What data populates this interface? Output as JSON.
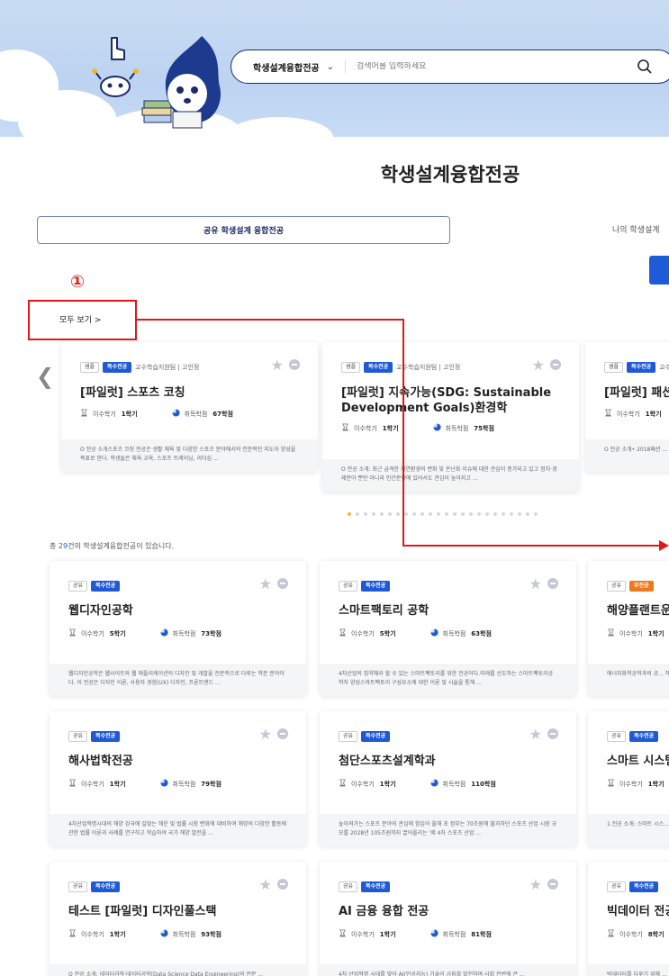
{
  "search": {
    "category": "학생설계융합전공",
    "placeholder": "검색어를 입력하세요"
  },
  "page_title": "학생설계융합전공",
  "tabs": [
    {
      "label": "공유 학생설계 융합전공"
    },
    {
      "label": "나의 학생설계"
    }
  ],
  "annotation_marker": "①",
  "view_all": "모두 보기 >",
  "total": {
    "prefix": "총 ",
    "count": "29",
    "suffix": "건의 학생설계융합전공이 있습니다."
  },
  "stats_labels": {
    "semester": "이수학기",
    "credits": "취득학점"
  },
  "featured": [
    {
      "tags": [
        "샘플",
        "복수전공"
      ],
      "meta": "교수학습지원팀 | 고인정",
      "title": "[파일럿] 스포츠 코칭",
      "semester": "1학기",
      "credits": "67학점",
      "desc": "O 전공 소개스포츠 코칭 전공은 생활 체육 및 다양한 스포츠 분야에서의 전문적인 지도자 양성을 목표로 한다. 학생들은 체육 교육, 스포츠 트레이닝, 리더십 ..."
    },
    {
      "tags": [
        "샘플",
        "복수전공"
      ],
      "meta": "교수학습지원팀 | 고인정",
      "title": "[파일럿] 지속가능(SDG: Sustainable Development Goals)환경학",
      "semester": "1학기",
      "credits": "75학점",
      "desc": "O 전공 소개: 최근 급격한 자연환경의 변화 및 온난화 이슈에 대한 관심이 증가되고 있고 정치·경제분야 뿐만 아니라 인간분야에 있어서도 관심이 높아지고 ..."
    },
    {
      "tags": [
        "샘플",
        "복수전공"
      ],
      "meta": "교수",
      "title": "[파일럿] 패션 ...",
      "semester": "1학기",
      "credits": "",
      "desc": "O 전공 소개• 2018패션 ... 디자인, 소비자학과가 융합 ..."
    }
  ],
  "dots": {
    "count": 24,
    "active_index": 0
  },
  "grid": [
    {
      "tags": [
        "공유",
        "복수전공"
      ],
      "title": "웹디자인공학",
      "semester": "5학기",
      "credits": "73학점",
      "desc": "웹디자인공학은 웹사이트와 웹 애플리케이션의 디자인 및 개발을 전문적으로 다루는 학문 분야이다. 이 전공은 디자인 이론, 사용자 경험(UX) 디자인, 프론트엔드 ..."
    },
    {
      "tags": [
        "공유",
        "복수전공"
      ],
      "title": "스마트팩토리 공학",
      "semester": "5학기",
      "credits": "63학점",
      "desc": "4차산업의 집약체라 할 수 있는 스마트팩토리를 위한 전공이다.미래를 선도하는 스마트팩토리공학자 양성스마트팩토리 구성요소에 대한 이론 및 시술을 통해 ..."
    },
    {
      "tags": [
        "공유",
        "부전공"
      ],
      "title": "해양플랜트운...",
      "semester": "1학기",
      "credits": "",
      "desc": "에너지화학공학과의 공... 해양에너지 자원개발에..."
    },
    {
      "tags": [
        "공유",
        "복수전공"
      ],
      "title": "해사법학전공",
      "semester": "1학기",
      "credits": "79학점",
      "desc": "4차산업혁명시대의 해양 강국에 걸맞는 해운 및 법률 시장 변화에 대비하여 해양의 다양한 활동에 관한 법률 이론과 사례를 연구하고 학습하여 국가 해양 발전을 ..."
    },
    {
      "tags": [
        "공유",
        "복수전공"
      ],
      "title": "첨단스포츠설계학과",
      "semester": "1학기",
      "credits": "110학점",
      "desc": "높아져가는 스포츠 분야의 관심에 힘입어 올해 초 정부는 70조원에 불과하던 스포츠 산업 시장 규모를 2028년 105조원까지 끌어올리는 '제 4차 스포츠 산업 ..."
    },
    {
      "tags": [
        "공유",
        "복수전공"
      ],
      "title": "스마트 시스템...",
      "semester": "1학기",
      "credits": "",
      "desc": "1.전공 소개: 스마트 시스... 해 미래의 첨단 기술을..."
    },
    {
      "tags": [
        "공유",
        "복수전공"
      ],
      "title": "테스트 [파일럿] 디자인풀스택",
      "semester": "1학기",
      "credits": "93학점",
      "desc": "O 전공 소개: 데이터과학·데이터공학(Data Science·Data Engineering)의 전문 ..."
    },
    {
      "tags": [
        "공유",
        "복수전공"
      ],
      "title": "AI 금융 융합 전공",
      "semester": "1학기",
      "credits": "81학점",
      "desc": "4차 산업혁명 시대를 맞아 AI(인공지능) 기술이 금융화 발전하며 사회 전반에 큰 ..."
    },
    {
      "tags": [
        "공유",
        "복수전공"
      ],
      "title": "빅데이터 전공...",
      "semester": "8학기",
      "credits": "",
      "desc": "빅데이터를 다루기 위해 ..."
    }
  ],
  "colors": {
    "accent": "#2059d6",
    "minor": "#ee7a1b",
    "annotation": "#e01818",
    "navy": "#1b2a63"
  }
}
